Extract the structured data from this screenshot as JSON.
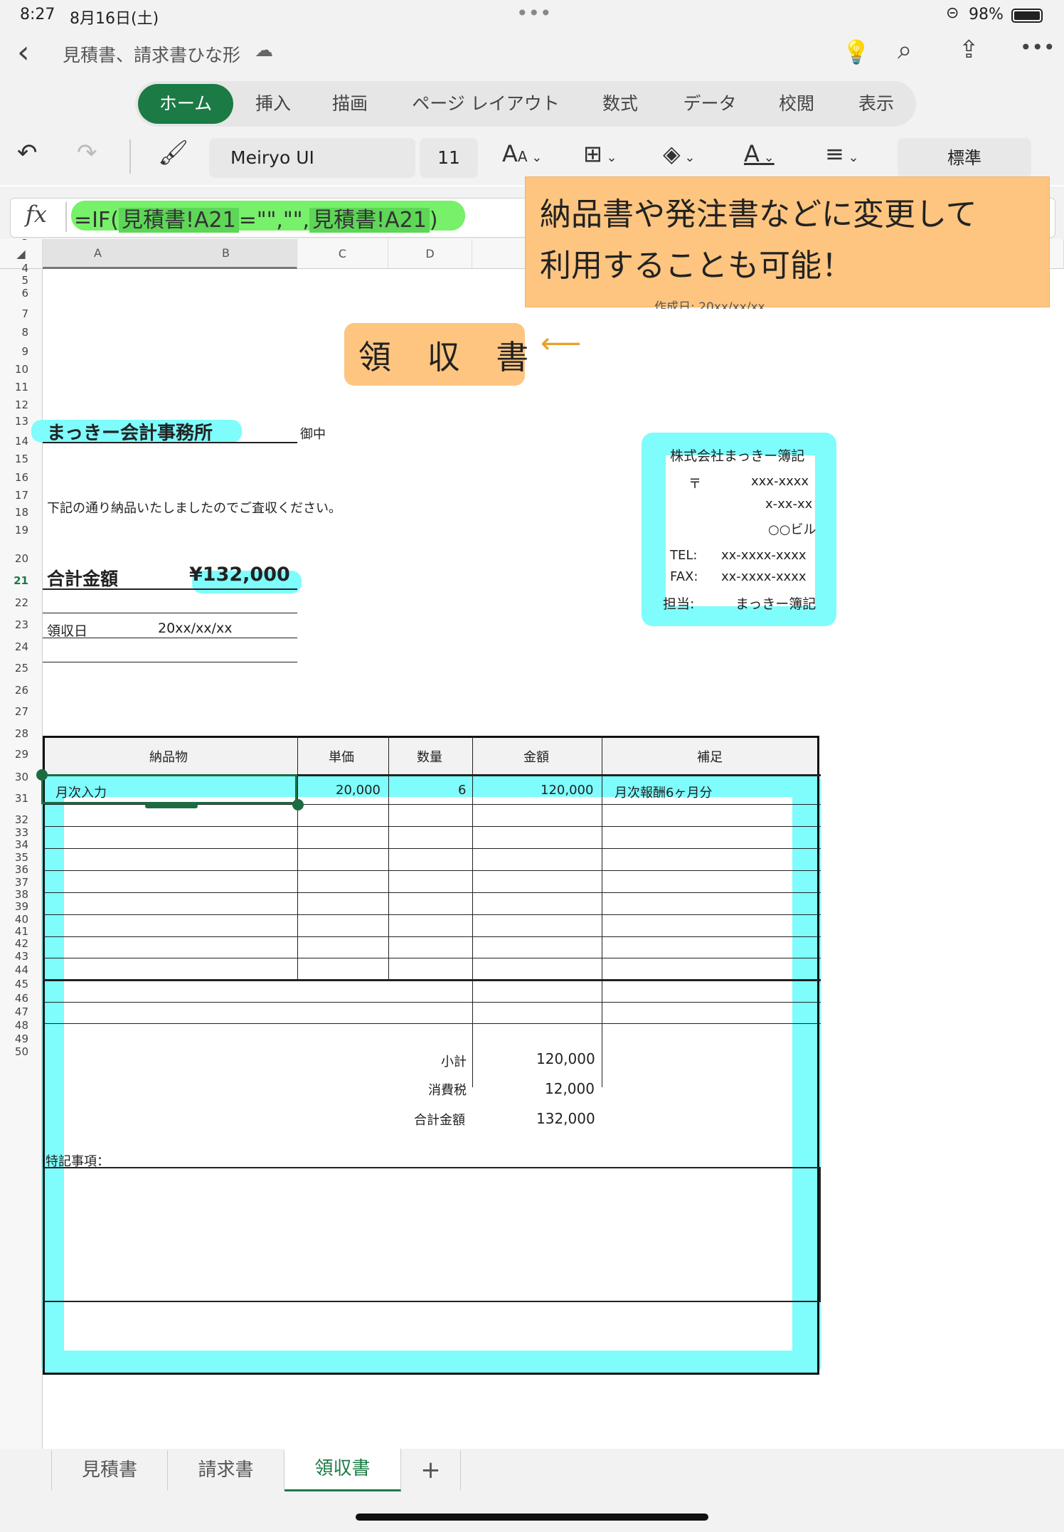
{
  "status": {
    "time": "8:27",
    "date": "8月16日(土)",
    "battery": "98%"
  },
  "doc": {
    "title": "見積書、請求書ひな形"
  },
  "ribbon": {
    "tabs": [
      "ホーム",
      "挿入",
      "描画",
      "ページ レイアウト",
      "数式",
      "データ",
      "校閲",
      "表示"
    ]
  },
  "toolbar": {
    "font": "Meiryo UI",
    "size": "11",
    "format": "標準"
  },
  "formula": {
    "fx": "fx",
    "pre": "=IF(",
    "ref1": "見積書!A21",
    "mid": "=\"\",\"\",",
    "ref2": "見積書!A21",
    "post": ")"
  },
  "callout": {
    "line1": "納品書や発注書などに変更して",
    "line2": "利用することも可能！",
    "partial": "作成日: 20xx/xx/xx"
  },
  "sheet": {
    "cols": [
      "A",
      "B",
      "C",
      "D"
    ],
    "title": "領 収 書",
    "client": "まっきー会計事務所",
    "onchu": "御中",
    "notice": "下記の通り納品いたしましたのでご査収ください。",
    "total_label": "合計金額",
    "total_value": "¥132,000",
    "date_label": "領収日",
    "date_value": "20xx/xx/xx",
    "company": {
      "name": "株式会社まっきー簿記",
      "zip_mark": "〒",
      "zip": "xxx-xxxx",
      "addr": "x-xx-xx",
      "bldg": "○○ビル",
      "tel_label": "TEL:",
      "tel": "xx-xxxx-xxxx",
      "fax_label": "FAX:",
      "fax": "xx-xxxx-xxxx",
      "rep_label": "担当:",
      "rep": "まっきー簿記"
    },
    "table_headers": [
      "納品物",
      "単価",
      "数量",
      "金額",
      "補足"
    ],
    "row21": {
      "item": "月次入力",
      "price": "20,000",
      "qty": "6",
      "amount": "120,000",
      "note": "月次報酬6ヶ月分"
    },
    "subtotal_label": "小計",
    "subtotal": "120,000",
    "tax_label": "消費税",
    "tax": "12,000",
    "grand_label": "合計金額",
    "grand": "132,000",
    "remarks_label": "特記事項："
  },
  "sheet_tabs": [
    "見積書",
    "請求書",
    "領収書",
    "+"
  ]
}
